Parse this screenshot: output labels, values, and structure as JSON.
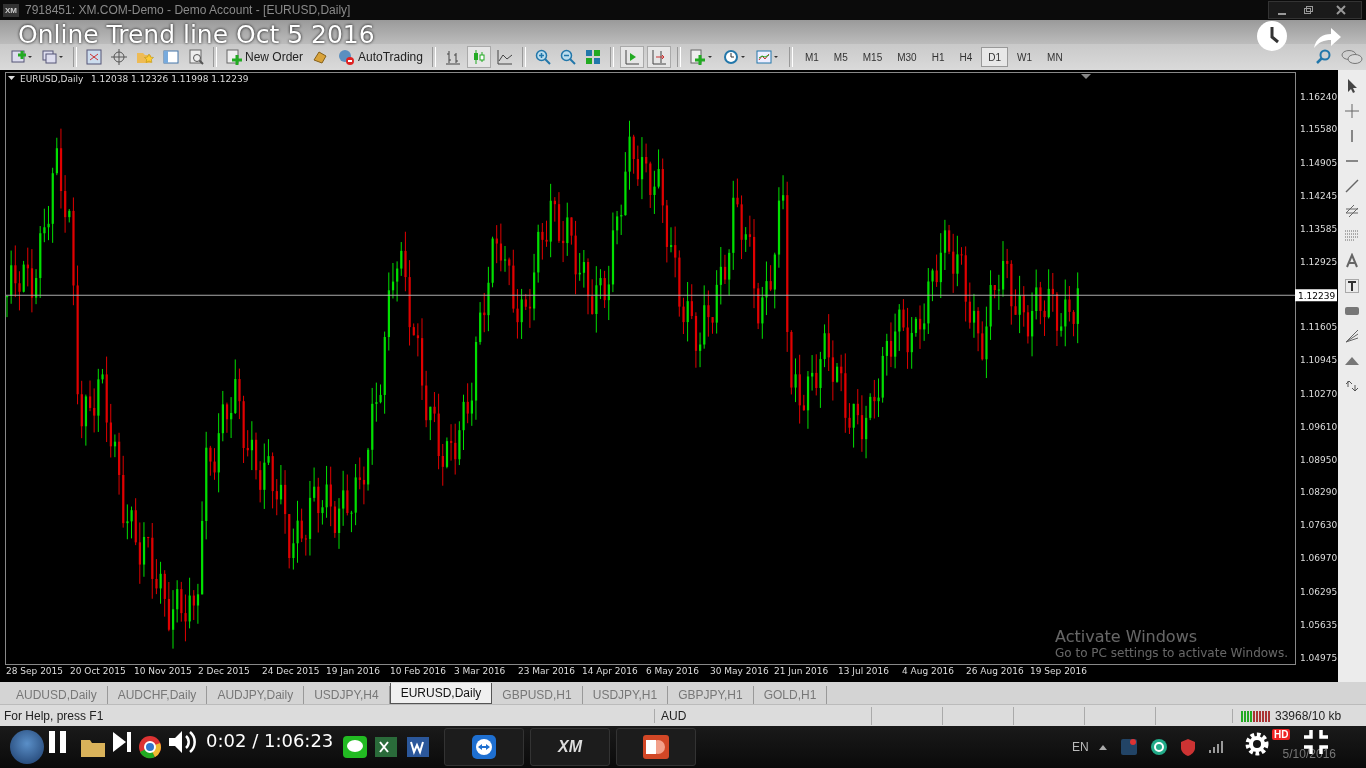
{
  "window": {
    "logo": "XM",
    "title": "7918451: XM.COM-Demo - Demo Account - [EURUSD,Daily]"
  },
  "video": {
    "title": "Online Trend line Oct 5 2016",
    "time": "0:02 / 1:06:23",
    "quality_badge": "HD"
  },
  "toolbar": {
    "new_order": "New Order",
    "auto_trading": "AutoTrading",
    "timeframes": [
      {
        "label": "M1",
        "selected": false
      },
      {
        "label": "M5",
        "selected": false
      },
      {
        "label": "M15",
        "selected": false
      },
      {
        "label": "M30",
        "selected": false
      },
      {
        "label": "H1",
        "selected": false
      },
      {
        "label": "H4",
        "selected": false
      },
      {
        "label": "D1",
        "selected": true
      },
      {
        "label": "W1",
        "selected": false
      },
      {
        "label": "MN",
        "selected": false
      }
    ]
  },
  "chart": {
    "symbol": "EURUSD,Daily",
    "quotes": "1.12038 1.12326 1.11998 1.12239",
    "current_price": "1.12239",
    "price_labels": [
      "1.16240",
      "1.15580",
      "1.14905",
      "1.14245",
      "1.13585",
      "1.12925",
      "1.11605",
      "1.10945",
      "1.10270",
      "1.09610",
      "1.08950",
      "1.08290",
      "1.07630",
      "1.06970",
      "1.06295",
      "1.05635",
      "1.04975"
    ],
    "date_labels": [
      "28 Sep 2015",
      "20 Oct 2015",
      "10 Nov 2015",
      "2 Dec 2015",
      "24 Dec 2015",
      "19 Jan 2016",
      "10 Feb 2016",
      "3 Mar 2016",
      "23 Mar 2016",
      "14 Apr 2016",
      "6 May 2016",
      "30 May 2016",
      "21 Jun 2016",
      "13 Jul 2016",
      "4 Aug 2016",
      "26 Aug 2016",
      "19 Sep 2016"
    ]
  },
  "tabs": [
    {
      "label": "AUDUSD,Daily",
      "selected": false
    },
    {
      "label": "AUDCHF,Daily",
      "selected": false
    },
    {
      "label": "AUDJPY,Daily",
      "selected": false
    },
    {
      "label": "USDJPY,H4",
      "selected": false
    },
    {
      "label": "EURUSD,Daily",
      "selected": true
    },
    {
      "label": "GBPUSD,H1",
      "selected": false
    },
    {
      "label": "USDJPY,H1",
      "selected": false
    },
    {
      "label": "GBPJPY,H1",
      "selected": false
    },
    {
      "label": "GOLD,H1",
      "selected": false
    }
  ],
  "status_bar": {
    "help": "For Help, press F1",
    "field_2": "AUD",
    "traffic": "33968/10 kb"
  },
  "activation_notice": {
    "title": "Activate Windows",
    "text": "Go to PC settings to activate Windows."
  },
  "taskbar": {
    "app_label": "XM",
    "language": "EN",
    "date": "5/10/2016"
  }
}
